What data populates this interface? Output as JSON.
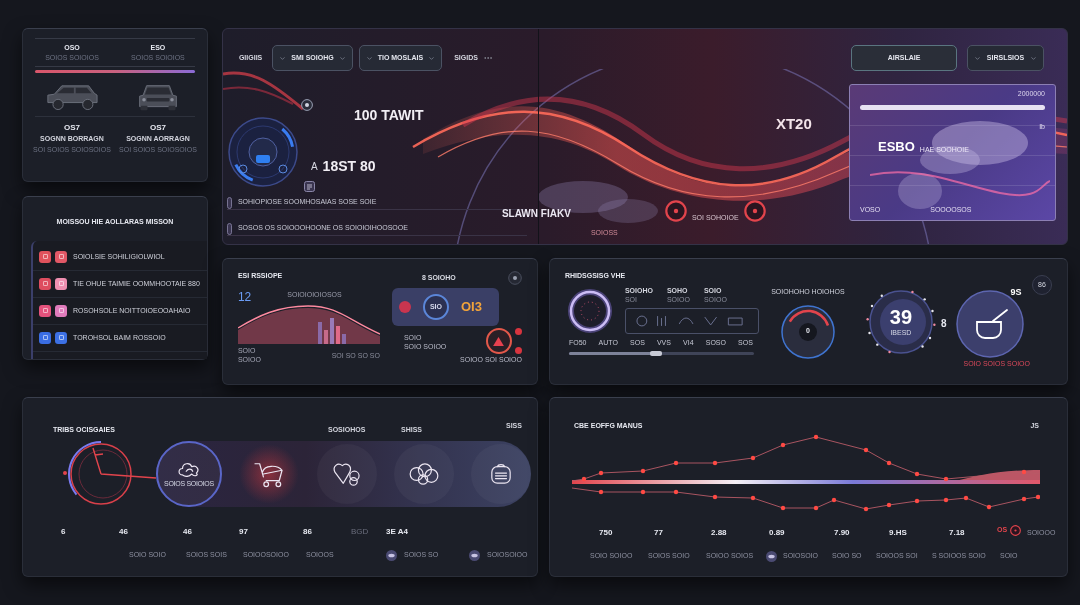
{
  "vehicle_card": {
    "columns": [
      {
        "heading": "OSO",
        "subtitle": "SOIOS SOIOIOS",
        "kind": "side",
        "value": "OS7",
        "label": "SOGNN BORRAGN",
        "note": "SOI SOIOS SOIOSOIOS"
      },
      {
        "heading": "ESO",
        "subtitle": "SOIOS SOIOIOS",
        "kind": "front",
        "value": "OS7",
        "label": "SOGNN AORRAGN",
        "note": "SOI SOIOS SOIOSOIOS"
      }
    ]
  },
  "mission_list": {
    "title": "MOISSOU HIE AOLLARAS MISSON",
    "items": [
      {
        "tiles": [
          {
            "color": "#e0525c"
          },
          {
            "color": "#e25866"
          }
        ],
        "label": "SOIOLSIE SOHILIGIOLWIOL"
      },
      {
        "tiles": [
          {
            "color": "#de4d5f"
          },
          {
            "color": "#ef8fb0"
          }
        ],
        "label": "TIE OHUE TAIMIE OOMMHOOTAIE 880"
      },
      {
        "tiles": [
          {
            "color": "#e4527c"
          },
          {
            "color": "#e07bbb"
          }
        ],
        "label": "ROSOHSOLE NOITTOIOEOOAHAIO"
      },
      {
        "tiles": [
          {
            "color": "#3a6de2"
          },
          {
            "color": "#3c70e4"
          }
        ],
        "label": "TOROHSOL BAIM ROSSOIO"
      }
    ]
  },
  "hero": {
    "toolbar": {
      "label": "GIIGIIS",
      "dropdowns": [
        {
          "value": "SMI SOIOHG"
        },
        {
          "value": "TIO MOSLAIS"
        }
      ],
      "status": "SIGIDS"
    },
    "headline": "100 TAWIT",
    "reading_prefix": "A",
    "reading": "18ST 80",
    "messages": [
      "SOHIOPIOSE SOOMHOSAIAS SOSE SOIE",
      "SOSOS OS SOIOOOHOONE OS SOIOIOIHOOSOOE"
    ],
    "caption": "SLAWN FIAKV",
    "marker": "XT20",
    "ring_caption": "SOI SOHOIOE",
    "footnote": "SOIOSS",
    "action_button": "AIRSLAIE",
    "filter": {
      "value": "SIRSLSIOS"
    },
    "map_panel": {
      "corner": "2000000",
      "value": "ESBO",
      "value_note": "HAE SOOHOIE",
      "side": "Ib",
      "bottom_left": "VOSO",
      "bottom": "SOOOOSOS"
    }
  },
  "signal_card": {
    "title": "ESI RSSIOPE",
    "value": "12",
    "chart_caption": "SOIOIOIOIOSOS",
    "legend": [
      "SOIO",
      "SOIOO"
    ],
    "axis": "SOI SO SO SO",
    "status": "8 SOIOHO",
    "panel_label": "SIO",
    "panel_reading": "OI3",
    "notes": [
      "SOIO",
      "SOIO SOIOO"
    ],
    "footer": "SOIOO SOI SOIOO"
  },
  "vitals_card": {
    "title": "RHIDSGSISG VHE",
    "stats": [
      {
        "label": "SOIOHO",
        "sub": "SOI"
      },
      {
        "label": "SOHO",
        "sub": "SOIOO"
      },
      {
        "label": "SOIO",
        "sub": "SOIOO"
      }
    ],
    "values": [
      "FO50",
      "AUTO",
      "SOS",
      "VVS",
      "VI4",
      "SOSO",
      "SOS"
    ],
    "slider": {
      "level": 0.47
    },
    "gauge": {
      "label": "SOIOHOHO HOIOHOS",
      "value": "0"
    },
    "dial": {
      "value": "39",
      "unit": "IBESD",
      "side": "8"
    },
    "cup": {
      "value": "9S"
    },
    "badge": "86",
    "alert": "SOIO SOIOS SOIOO"
  },
  "trips_card": {
    "title": "TRIBS OCISGAIES",
    "headers": [
      "SOSIOHOS",
      "SHISS",
      "SISS"
    ],
    "modes": [
      {
        "kind": "cloud",
        "caption": "SOIOS SOIOIOS",
        "selected": false
      },
      {
        "kind": "stroller",
        "selected": true
      },
      {
        "kind": "hearts",
        "selected": false
      },
      {
        "kind": "clouds",
        "selected": false
      },
      {
        "kind": "radio",
        "selected": false
      }
    ],
    "values": [
      {
        "text": "6",
        "dim": false
      },
      {
        "text": "46",
        "dim": false
      },
      {
        "text": "46",
        "dim": false
      },
      {
        "text": "97",
        "dim": false
      },
      {
        "text": "86",
        "dim": false
      },
      {
        "text": "BGD",
        "dim": true
      },
      {
        "text": "3E A4",
        "dim": false
      }
    ],
    "notes": [
      {
        "text": "SOIO SOIO",
        "icon": false
      },
      {
        "text": "SOIOS SOIS",
        "icon": false
      },
      {
        "text": "SOIOOSOIOO",
        "icon": false
      },
      {
        "text": "SOIOOS",
        "icon": false
      },
      {
        "text": "SOIOS SO",
        "icon": true
      },
      {
        "text": "SOIOSOIOO",
        "icon": true
      }
    ]
  },
  "trend_card": {
    "title": "CBE EOFFG MANUS",
    "corner": "JS",
    "values": [
      {
        "text": "750",
        "kind": "plain"
      },
      {
        "text": "77",
        "kind": "plain"
      },
      {
        "text": "2.88",
        "kind": "plain"
      },
      {
        "text": "0.89",
        "kind": "plain"
      },
      {
        "text": "7.90",
        "kind": "plain"
      },
      {
        "text": "9.HS",
        "kind": "plain"
      },
      {
        "text": "7.18",
        "kind": "plain"
      },
      {
        "text": "OS",
        "kind": "alert"
      },
      {
        "text": "SOIOOO",
        "kind": "muted"
      }
    ],
    "notes": [
      {
        "text": "SOIO SOIOO",
        "icon": false
      },
      {
        "text": "SOIOS SOIO",
        "icon": false
      },
      {
        "text": "SOIOO SOIOS",
        "icon": false
      },
      {
        "text": "SOIOSOIO",
        "icon": true
      },
      {
        "text": "SOIO SO",
        "icon": false
      },
      {
        "text": "SOIOOS SOI",
        "icon": false
      },
      {
        "text": "S SOIOOS SOIO",
        "icon": false
      },
      {
        "text": "SOIO",
        "icon": false
      }
    ]
  }
}
